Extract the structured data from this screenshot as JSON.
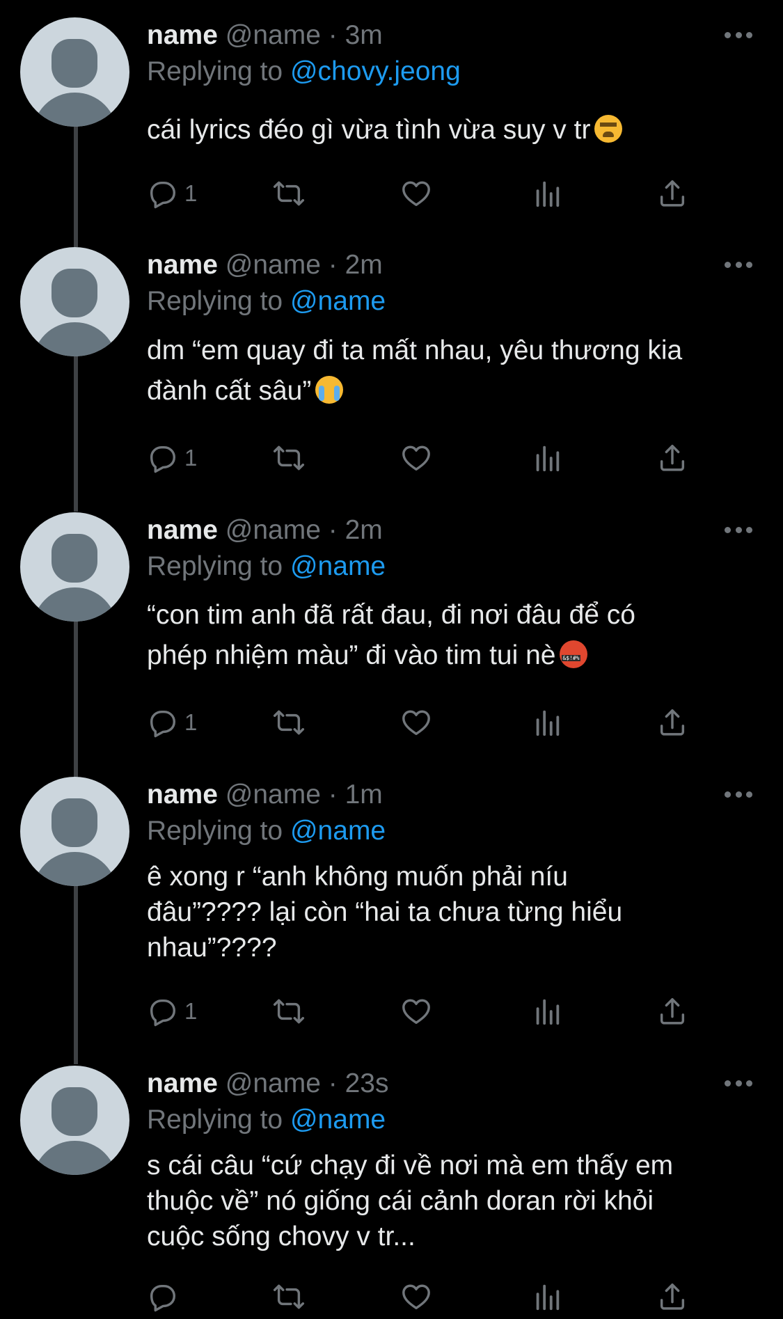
{
  "colors": {
    "background": "#000000",
    "text": "#e7e9ea",
    "secondary": "#71767b",
    "link": "#1d9bf0",
    "thread_line": "#3e4144",
    "avatar_bg": "#ccd6dd",
    "avatar_fg": "#66757f"
  },
  "tweets": [
    {
      "display_name": "name",
      "handle": "@name",
      "separator": "·",
      "time": "3m",
      "replying_label": "Replying to",
      "replying_to": "@chovy.jeong",
      "text": "cái lyrics đéo gì vừa tình vừa suy v tr",
      "emoji": "tired-face-icon",
      "reply_count": "1"
    },
    {
      "display_name": "name",
      "handle": "@name",
      "separator": "·",
      "time": "2m",
      "replying_label": "Replying to",
      "replying_to": "@name",
      "text": "dm “em quay đi ta mất nhau, yêu thương kia\nđành cất sâu”",
      "emoji": "loudly-crying-face-icon",
      "reply_count": "1"
    },
    {
      "display_name": "name",
      "handle": "@name",
      "separator": "·",
      "time": "2m",
      "replying_label": "Replying to",
      "replying_to": "@name",
      "text": "“con tim anh đã rất đau, đi nơi đâu để có\nphép nhiệm màu” đi vào tim tui nè",
      "emoji": "face-with-symbols-icon",
      "reply_count": "1"
    },
    {
      "display_name": "name",
      "handle": "@name",
      "separator": "·",
      "time": "1m",
      "replying_label": "Replying to",
      "replying_to": "@name",
      "text": "ê xong r “anh không muốn phải níu\nđâu”???? lại còn “hai ta chưa từng hiểu\nnhau”????",
      "emoji": "",
      "reply_count": "1"
    },
    {
      "display_name": "name",
      "handle": "@name",
      "separator": "·",
      "time": "23s",
      "replying_label": "Replying to",
      "replying_to": "@name",
      "text": "s cái câu “cứ chạy đi về nơi mà em thấy em\nthuộc về” nó giống cái cảnh doran rời khỏi\ncuộc sống chovy v tr...",
      "emoji": "",
      "reply_count": ""
    }
  ],
  "icons": {
    "reply": "reply-icon",
    "retweet": "retweet-icon",
    "like": "like-icon",
    "views": "views-icon",
    "share": "share-icon",
    "more": "more-icon"
  }
}
